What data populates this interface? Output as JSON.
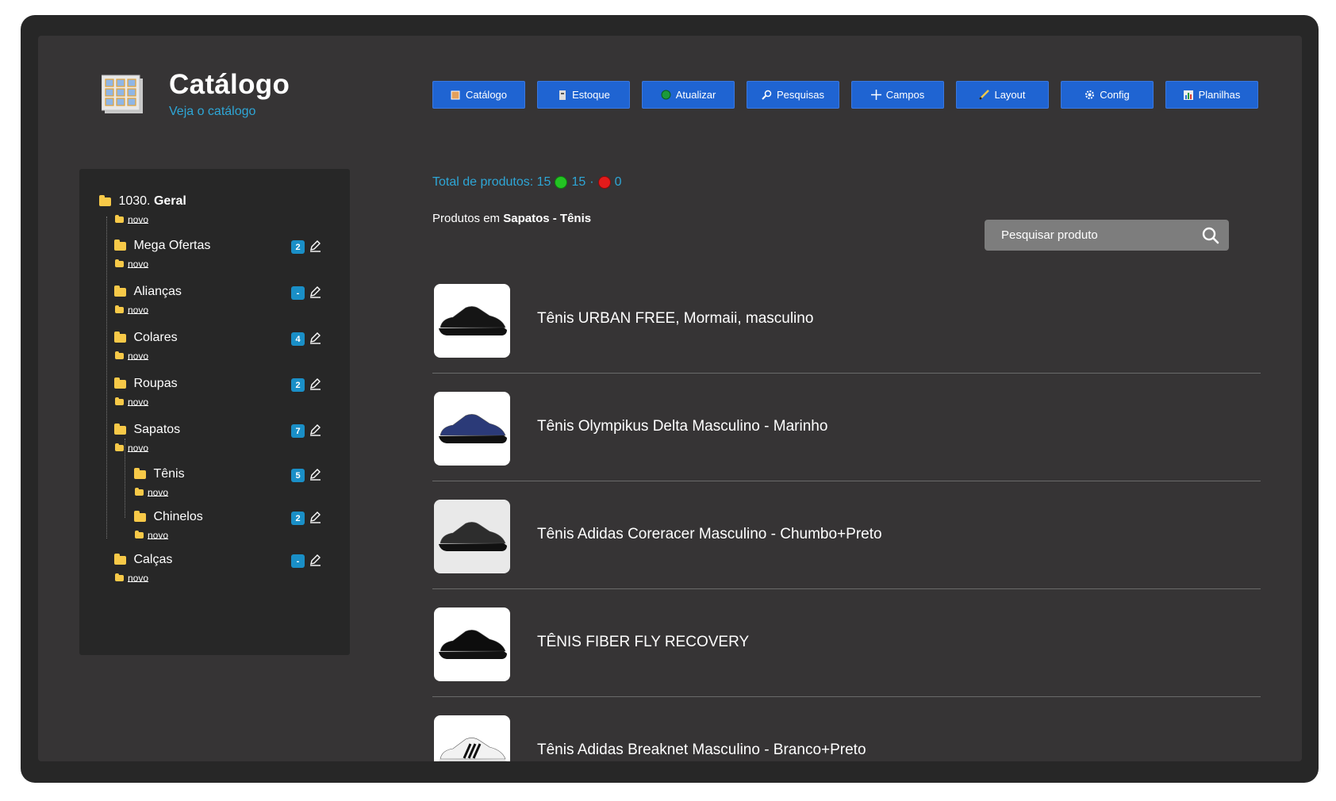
{
  "header": {
    "title": "Catálogo",
    "subtitle": "Veja o catálogo"
  },
  "toolbar": [
    {
      "label": "Catálogo",
      "icon": "book-icon"
    },
    {
      "label": "Estoque",
      "icon": "box-icon"
    },
    {
      "label": "Atualizar",
      "icon": "refresh-icon"
    },
    {
      "label": "Pesquisas",
      "icon": "magnifier-icon"
    },
    {
      "label": "Campos",
      "icon": "plus-icon"
    },
    {
      "label": "Layout",
      "icon": "pencil-icon"
    },
    {
      "label": "Config",
      "icon": "gear-icon"
    },
    {
      "label": "Planilhas",
      "icon": "chart-icon"
    }
  ],
  "tree": {
    "root": {
      "number": "1030.",
      "name": "Geral",
      "new_label": "novo"
    },
    "items": [
      {
        "label": "Mega Ofertas",
        "count": "2",
        "new_label": "novo"
      },
      {
        "label": "Alianças",
        "count": "-",
        "new_label": "novo"
      },
      {
        "label": "Colares",
        "count": "4",
        "new_label": "novo"
      },
      {
        "label": "Roupas",
        "count": "2",
        "new_label": "novo"
      },
      {
        "label": "Sapatos",
        "count": "7",
        "new_label": "novo"
      },
      {
        "label": "Tênis",
        "count": "5",
        "new_label": "novo"
      },
      {
        "label": "Chinelos",
        "count": "2",
        "new_label": "novo"
      },
      {
        "label": "Calças",
        "count": "-",
        "new_label": "novo"
      }
    ]
  },
  "summary": {
    "total_label": "Total de produtos: 15",
    "green_count": "15",
    "separator": "·",
    "red_count": "0"
  },
  "products_heading": {
    "prefix": "Produtos em",
    "category": "Sapatos - Tênis"
  },
  "search": {
    "placeholder": "Pesquisar produto"
  },
  "products": [
    {
      "name": "Tênis URBAN FREE, Mormaii, masculino",
      "thumb_bg": "#ffffff",
      "shoe_color": "#151515"
    },
    {
      "name": "Tênis Olympikus Delta Masculino - Marinho",
      "thumb_bg": "#ffffff",
      "shoe_color": "#2b3a78"
    },
    {
      "name": "Tênis Adidas Coreracer Masculino - Chumbo+Preto",
      "thumb_bg": "#e9e9e9",
      "shoe_color": "#2d2d2d"
    },
    {
      "name": "TÊNIS FIBER FLY RECOVERY",
      "thumb_bg": "#ffffff",
      "shoe_color": "#0d0d0d"
    },
    {
      "name": "Tênis Adidas Breaknet Masculino - Branco+Preto",
      "thumb_bg": "#ffffff",
      "shoe_color": "#f2f2f2"
    }
  ]
}
